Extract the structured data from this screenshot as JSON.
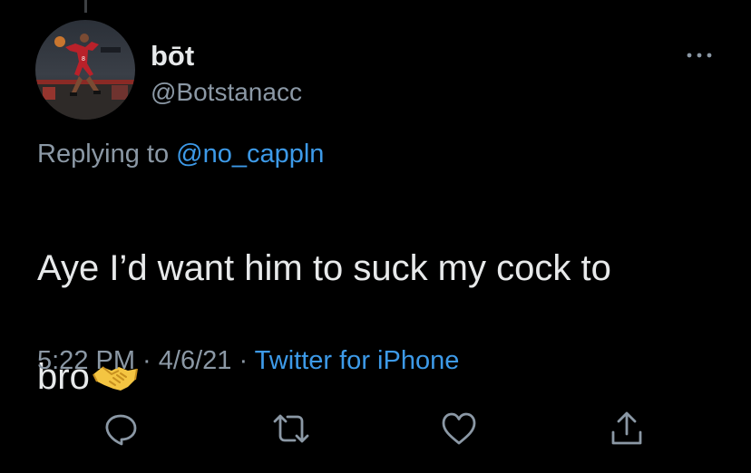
{
  "tweet": {
    "author": {
      "display_name": "bōt",
      "handle": "@Botstanacc",
      "avatar_icon": "avatar-basketball-player"
    },
    "reply": {
      "prefix": "Replying to ",
      "mention": "@no_cappln"
    },
    "text_line1": "Aye I’d want him to suck my cock to",
    "text_line2": "bro",
    "emoji_icon": "handshake-emoji",
    "meta": {
      "time": "5:22 PM",
      "separator1": " · ",
      "date": "4/6/21",
      "separator2": " · ",
      "source": "Twitter for iPhone"
    },
    "actions": {
      "reply_icon": "reply-icon",
      "retweet_icon": "retweet-icon",
      "like_icon": "heart-icon",
      "share_icon": "share-icon"
    }
  },
  "colors": {
    "background": "#000000",
    "text_primary": "#e7e9ea",
    "text_secondary": "#8b98a5",
    "link": "#3d9ae8"
  }
}
